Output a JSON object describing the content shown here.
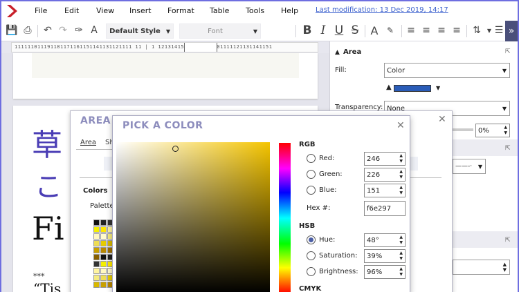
{
  "menu": {
    "items": [
      "File",
      "Edit",
      "View",
      "Insert",
      "Format",
      "Table",
      "Tools",
      "Help"
    ],
    "last_modification": "Last modification:  13 Dec 2019, 14:17"
  },
  "toolbar": {
    "paragraph_style": "Default Style",
    "font_name": "Font"
  },
  "ruler": {
    "marks": "111111011191181171161151141131121111 11 | 1 12131415161718191101111121131141151"
  },
  "document": {
    "line1": "草",
    "line2": "こ",
    "line3": "Fi",
    "line4": "***",
    "line5": "“Tis"
  },
  "sidebar": {
    "area_title": "Area",
    "fill_label": "Fill:",
    "fill_value": "Color",
    "transparency_label": "Transparency:",
    "transparency_value": "None",
    "transparency_percent": "0%",
    "fill_color": "#2a5cb8"
  },
  "area_dialog": {
    "title": "AREA",
    "tabs": [
      "Area",
      "Sh"
    ],
    "colors_label": "Colors",
    "palette_label": "Palette",
    "palette_colors": [
      "#111111",
      "#222222",
      "#333333",
      "#f4f000",
      "#ffe800",
      "#fff4a0",
      "#fff8c0",
      "#fffacc",
      "#f5eb80",
      "#eedd55",
      "#e6cc00",
      "#d8b800",
      "#c8a000",
      "#b88800",
      "#a07000",
      "#886000"
    ]
  },
  "pick_dialog": {
    "title": "PICK A COLOR",
    "rgb": {
      "title": "RGB",
      "red_label": "Red:",
      "red": "246",
      "green_label": "Green:",
      "green": "226",
      "blue_label": "Blue:",
      "blue": "151",
      "hex_label": "Hex #:",
      "hex": "f6e297"
    },
    "hsb": {
      "title": "HSB",
      "hue_label": "Hue:",
      "hue": "48°",
      "saturation_label": "Saturation:",
      "saturation": "39%",
      "brightness_label": "Brightness:",
      "brightness": "96%"
    },
    "cmyk_title": "CMYK"
  }
}
